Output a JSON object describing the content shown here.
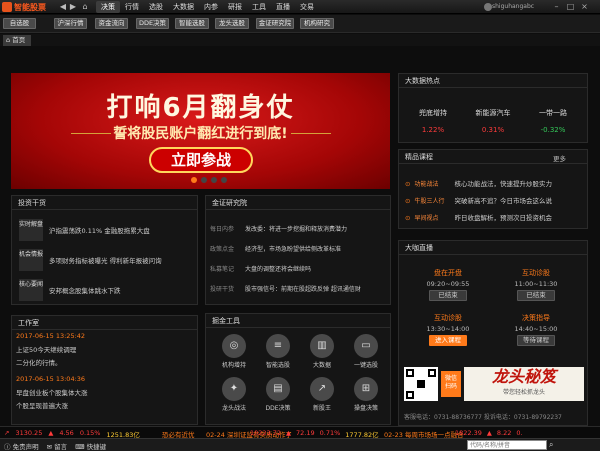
{
  "app": {
    "name": "智能股票",
    "user": "shiguhangabc"
  },
  "menu": [
    "决策",
    "行情",
    "选股",
    "大数据",
    "内参",
    "研报",
    "工具",
    "直播",
    "交易"
  ],
  "toolbar": [
    "自选股",
    "沪深行情",
    "资金流向",
    "DDE决策",
    "智能选股",
    "龙头选股",
    "金证研究院",
    "机构研究"
  ],
  "home_tab": "首页",
  "banner": {
    "title": "打响6月翻身仗",
    "subtitle": "誓将股民账户翻红进行到底!",
    "cta": "立即参战"
  },
  "hotspot": {
    "title": "大数据热点",
    "stocks": [
      {
        "name": "兜底增持",
        "value": "1.22%"
      },
      {
        "name": "新能源汽车",
        "value": "0.31%"
      },
      {
        "name": "一带一路",
        "value": "-0.32%"
      }
    ]
  },
  "courses": {
    "title": "精品课程",
    "more": "更多",
    "items": [
      {
        "tag": "功能战法",
        "text": "核心功能战法，快速提升炒股实力"
      },
      {
        "tag": "牛股三人行",
        "text": "突破新高不追？今日市场会这么说"
      },
      {
        "tag": "早间视点",
        "text": "昨日收盘解析，预测次日投资机会"
      }
    ]
  },
  "live": {
    "title": "大咖直播",
    "sessions": [
      {
        "name": "盘在开盘",
        "time": "09:20~09:55",
        "btn": "已结束"
      },
      {
        "name": "互动诊股",
        "time": "11:00~11:30",
        "btn": "已结束"
      },
      {
        "name": "互动诊股",
        "time": "13:30~14:00",
        "btn": "进入课程"
      },
      {
        "name": "决策指导",
        "time": "14:40~15:00",
        "btn": "等待课程"
      }
    ]
  },
  "qr": {
    "text": "微信\n扫码"
  },
  "promo": {
    "title": "龙头秘笈",
    "sub": "带您轻松抓龙头"
  },
  "contact": "客服电话：0731-88736777   投诉电话：0731-89792237",
  "advisor": {
    "title": "投资干货",
    "items": [
      {
        "tag": "实时解盘",
        "text": "沪指震荡跌0.11% 金融股拖累大盘"
      },
      {
        "tag": "机会情报",
        "text": "多项财务指标被曝光 得利新年报被问询"
      },
      {
        "tag": "核心要闻",
        "text": "安邦概念股集体跳水下跌"
      }
    ]
  },
  "research": {
    "title": "金证研究院",
    "items": [
      {
        "tag": "每日内参",
        "text": "发改委：将进一步挖掘和释放消费潜力"
      },
      {
        "tag": "政策点金",
        "text": "经济型，市场急盼望供给侧改革标准"
      },
      {
        "tag": "私募笔记",
        "text": "大盘的调整还将会继续吗"
      },
      {
        "tag": "投研干货",
        "text": "股市强信号：前期在股超跌反弹 超讯通信财"
      }
    ]
  },
  "studio": {
    "title": "工作室",
    "posts": [
      {
        "time": "2017-06-15 13:25:42",
        "text": "上证50今天继续调理",
        "text2": "二分化的行情。"
      },
      {
        "time": "2017-06-15 13:04:36",
        "text": "早盘创业板个股集体大涨",
        "text2": "个股呈现普遍大涨"
      }
    ]
  },
  "tools": {
    "title": "掘金工具",
    "items": [
      "机构增持",
      "智能选股",
      "大数据",
      "一键选股",
      "龙头战法",
      "DDE决策",
      "新股王",
      "操盘决策"
    ]
  },
  "status": {
    "sh": "3130.25",
    "sh_chg": "4.56",
    "sh_pct": "0.15%",
    "sh_amt": "1251.83亿",
    "news1": "恐必有近优",
    "news2": "02-24 深圳证监有实质动作了",
    "sz": "10223.72",
    "sz_chg": "72.19",
    "sz_pct": "0.71%",
    "sz_amt": "1777.82亿",
    "news3": "02-23 每周市场场一点融合",
    "cy": "1822.39",
    "cy_chg": "8.22",
    "cy_pct": "0."
  },
  "bottom": {
    "items": [
      "免责声明",
      "留言",
      "快捷键"
    ],
    "search_placeholder": "代码/名称/拼音"
  },
  "colors": {
    "accent": "#ff7a1a",
    "up": "#ff3b3b",
    "down": "#34c759"
  }
}
